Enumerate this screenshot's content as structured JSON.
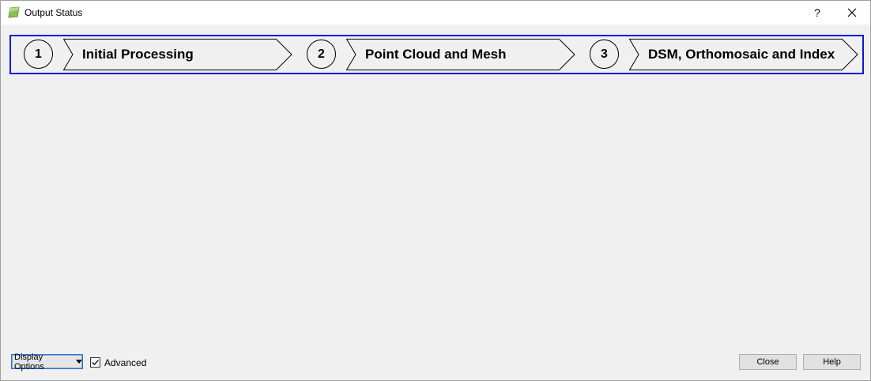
{
  "window": {
    "title": "Output Status",
    "help_glyph": "?",
    "close_glyph": "✕"
  },
  "steps": [
    {
      "number": "1",
      "label": "Initial Processing"
    },
    {
      "number": "2",
      "label": "Point Cloud and Mesh"
    },
    {
      "number": "3",
      "label": "DSM, Orthomosaic and Index"
    }
  ],
  "footer": {
    "display_options_label": "Display Options",
    "advanced_label": "Advanced",
    "advanced_checked": true,
    "close_label": "Close",
    "help_label": "Help"
  },
  "colors": {
    "step_frame_border": "#0a18d6",
    "app_icon": "#7ab648"
  }
}
